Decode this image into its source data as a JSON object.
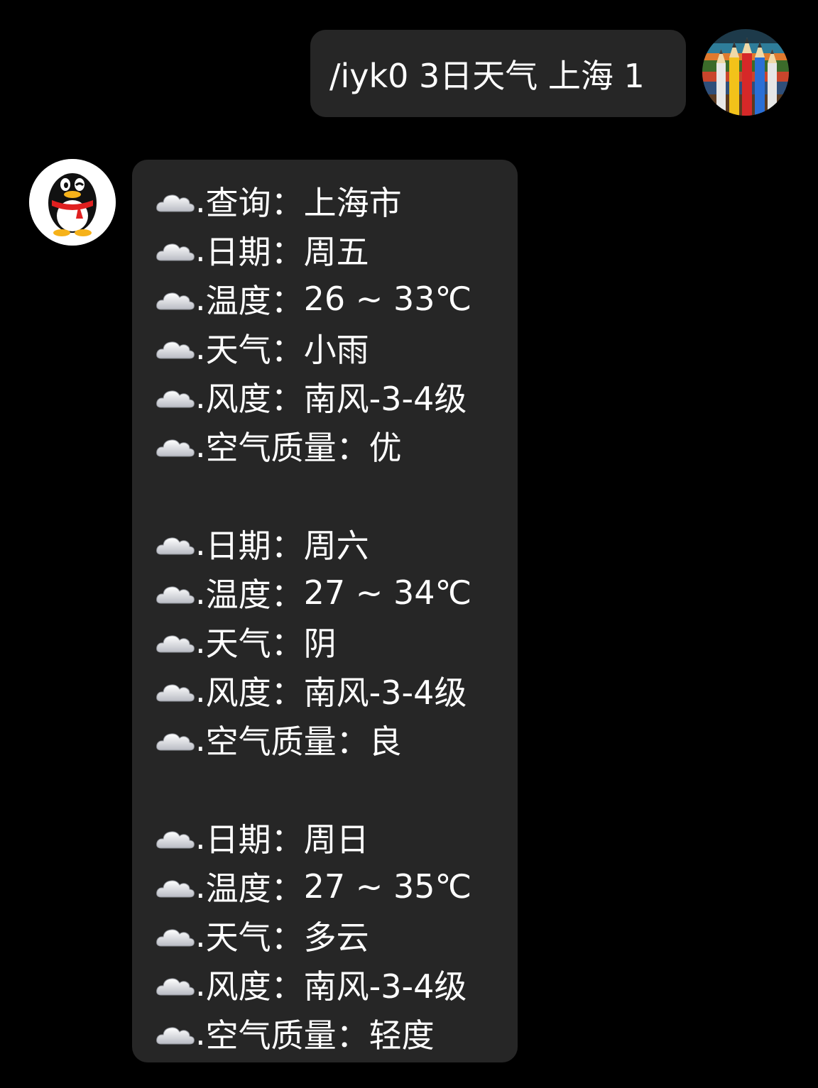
{
  "outgoing": {
    "text": "/iyk0 3日天气 上海 1",
    "avatar_icon": "pencils-avatar-icon"
  },
  "incoming": {
    "avatar_icon": "qq-penguin-avatar-icon",
    "bullet_icon": "cloud-icon",
    "lines": [
      {
        "label": "查询",
        "value": "上海市"
      },
      {
        "label": "日期",
        "value": "周五"
      },
      {
        "label": "温度",
        "value": "26 ~ 33℃"
      },
      {
        "label": "天气",
        "value": "小雨"
      },
      {
        "label": "风度",
        "value": "南风-3-4级"
      },
      {
        "label": "空气质量",
        "value": "优"
      },
      null,
      {
        "label": "日期",
        "value": "周六"
      },
      {
        "label": "温度",
        "value": "27 ~ 34℃"
      },
      {
        "label": "天气",
        "value": "阴"
      },
      {
        "label": "风度",
        "value": "南风-3-4级"
      },
      {
        "label": "空气质量",
        "value": "良"
      },
      null,
      {
        "label": "日期",
        "value": "周日"
      },
      {
        "label": "温度",
        "value": "27 ~ 35℃"
      },
      {
        "label": "天气",
        "value": "多云"
      },
      {
        "label": "风度",
        "value": "南风-3-4级"
      },
      {
        "label": "空气质量",
        "value": "轻度"
      }
    ]
  },
  "colors": {
    "background": "#000000",
    "bubble": "#262626",
    "text": "#ffffff"
  }
}
